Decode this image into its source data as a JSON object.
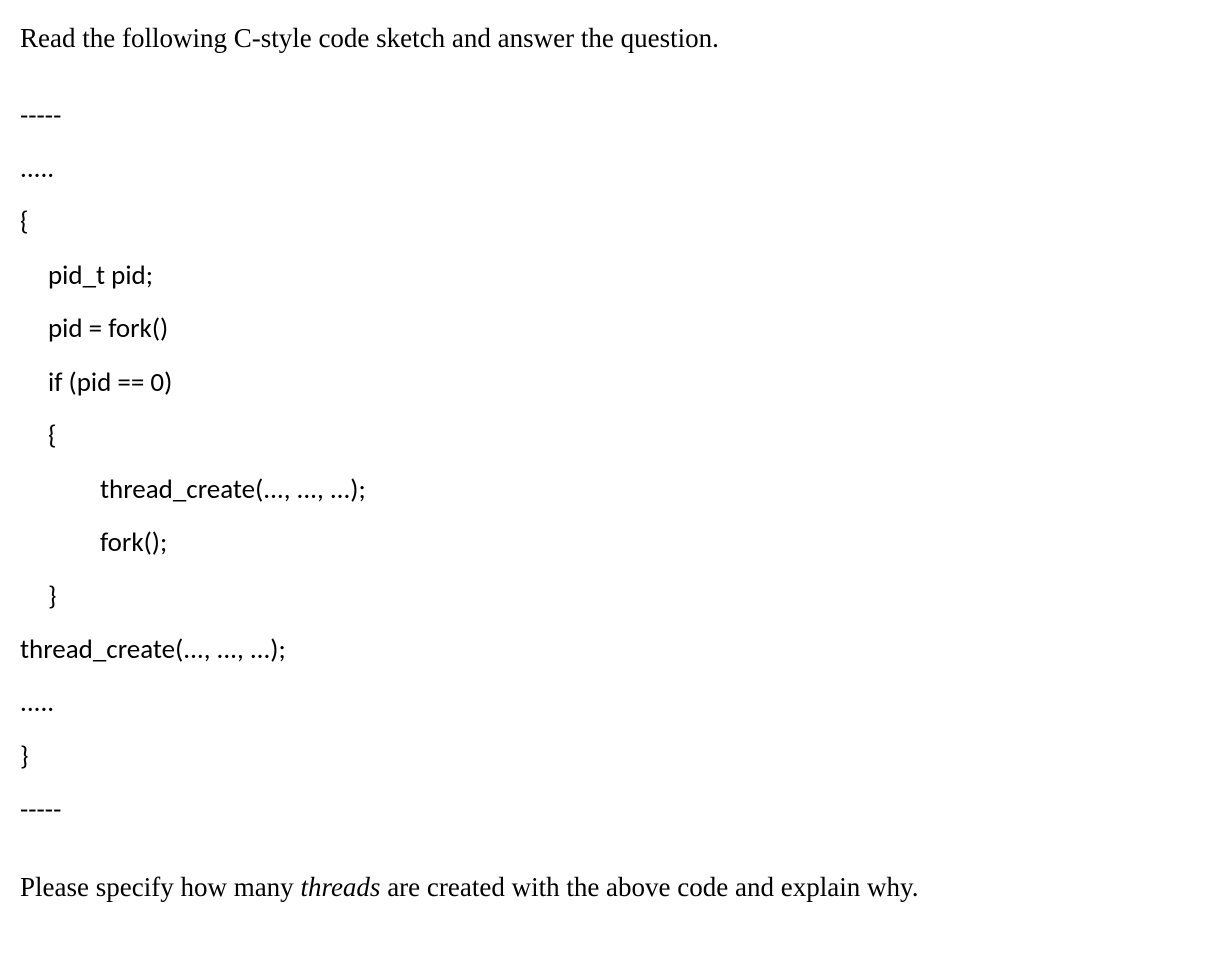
{
  "intro": "Read the following C-style code sketch and answer the question.",
  "code": {
    "sep_top": "-----",
    "ellipsis1": ".....",
    "open_brace": "{",
    "line_pid_decl": "pid_t pid;",
    "line_pid_fork": "pid = fork()",
    "line_if": "if (pid == 0)",
    "line_inner_open": "{",
    "line_thread1": "thread_create(..., ..., ...);",
    "line_fork2": "fork();",
    "line_inner_close": "}",
    "line_thread2": "thread_create(..., ..., ...);",
    "ellipsis2": ".....",
    "close_brace": "}",
    "sep_bottom": "-----"
  },
  "question": {
    "prefix": "Please specify how many ",
    "italic_word": "threads",
    "suffix": " are created with the above code and explain why."
  }
}
